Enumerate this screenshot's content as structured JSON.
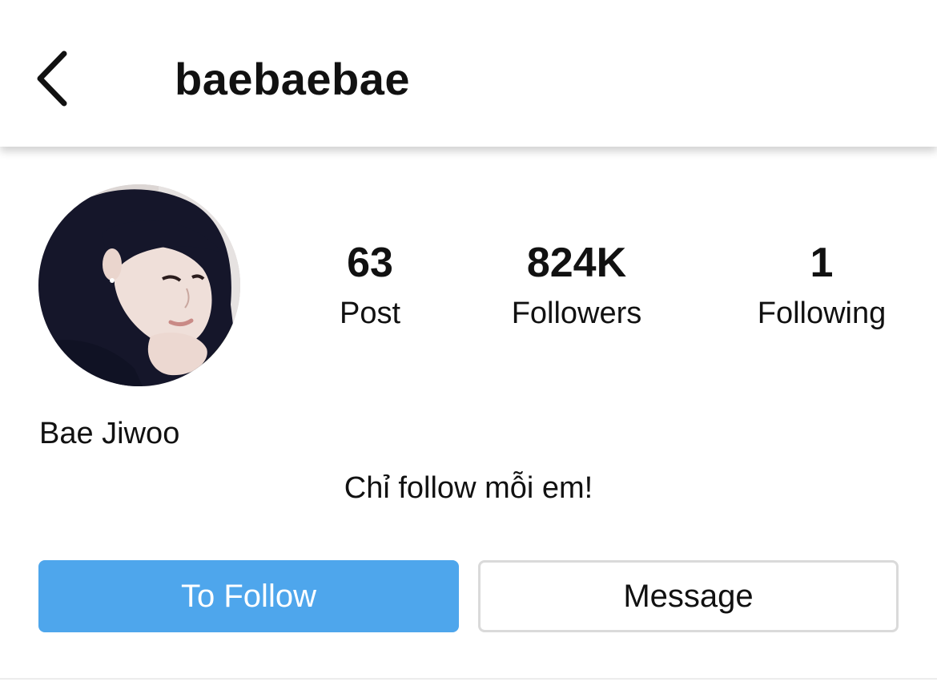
{
  "header": {
    "back_icon": "chevron-left-icon",
    "title": "baebaebae"
  },
  "profile": {
    "avatar_description": "profile-photo",
    "display_name": "Bae Jiwoo",
    "bio": "Chỉ follow mỗi em!"
  },
  "stats": {
    "posts": {
      "value": "63",
      "label": "Post"
    },
    "followers": {
      "value": "824K",
      "label": "Followers"
    },
    "following": {
      "value": "1",
      "label": "Following"
    }
  },
  "actions": {
    "follow_label": "To Follow",
    "message_label": "Message"
  },
  "colors": {
    "accent": "#4ea6ec",
    "text": "#111111",
    "border": "#dadada"
  }
}
